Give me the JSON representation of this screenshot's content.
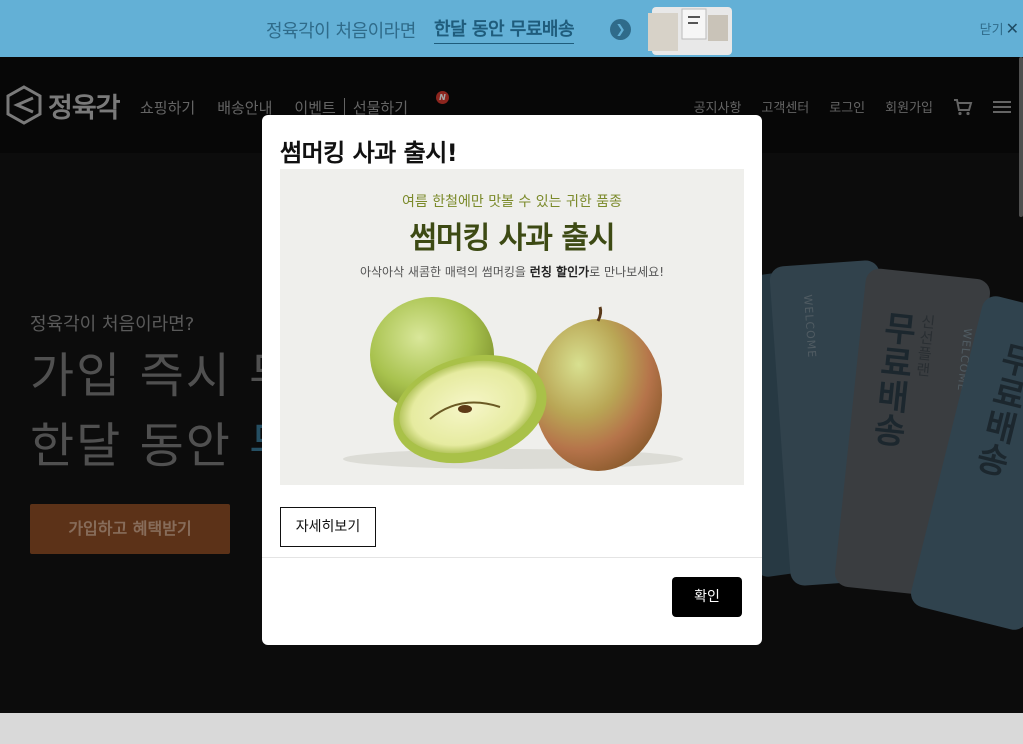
{
  "promo": {
    "text": "정육각이 처음이라면",
    "strong": "한달 동안 무료배송",
    "arrow_icon": "chevron-right-icon",
    "close_label": "닫기",
    "close_icon": "✕"
  },
  "header": {
    "logo_text": "정육각",
    "nav": [
      "쇼핑하기",
      "배송안내",
      "이벤트",
      "선물하기"
    ],
    "new_badge": "N",
    "util": [
      "공지사항",
      "고객센터",
      "로그인",
      "회원가입"
    ],
    "cart_icon": "cart-icon",
    "menu_icon": "menu-icon"
  },
  "hero": {
    "sub": "정육각이 처음이라면?",
    "line1": "가입 즉시 무",
    "line2_plain": "한달 동안 ",
    "line2_highlight": "무",
    "cta": "가입하고 혜택받기",
    "ticket_welcome": "WELCOME",
    "ticket_plan": "신선플랜",
    "ticket_text": "무료배송"
  },
  "modal": {
    "title": "썸머킹 사과 출시!",
    "image": {
      "sub": "여름 한철에만 맛볼 수 있는 귀한 품종",
      "title": "썸머킹 사과 출시",
      "desc_pre": "아삭아삭 새콤한 매력의 썸머킹을 ",
      "desc_bold": "런칭 할인가",
      "desc_post": "로 만나보세요!"
    },
    "detail_button": "자세히보기",
    "confirm_button": "확인"
  }
}
